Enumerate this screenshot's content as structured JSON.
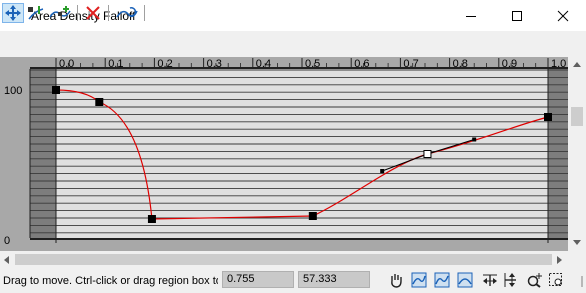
{
  "window": {
    "title": "Area Density Falloff"
  },
  "graph": {
    "x_ticks": [
      "0.0",
      "0.1",
      "0.2",
      "0.3",
      "0.4",
      "0.5",
      "0.6",
      "0.7",
      "0.8",
      "0.9",
      "1.0"
    ],
    "y_labels": {
      "top": "100",
      "bottom": "0"
    },
    "curve_color": "#e00000",
    "points": [
      {
        "x": 0.0,
        "y": 100
      },
      {
        "x": 0.088,
        "y": 92
      },
      {
        "x": 0.195,
        "y": 14
      },
      {
        "x": 0.522,
        "y": 16
      },
      {
        "x": 0.755,
        "y": 57.333
      },
      {
        "x": 1.0,
        "y": 82
      }
    ],
    "selected_tangents": [
      {
        "x": 0.663,
        "y": 46
      },
      {
        "x": 0.85,
        "y": 67
      }
    ]
  },
  "status": {
    "message": "Drag to move. Ctrl-click or drag region box to",
    "x_value": "0.755",
    "y_value": "57.333"
  }
}
